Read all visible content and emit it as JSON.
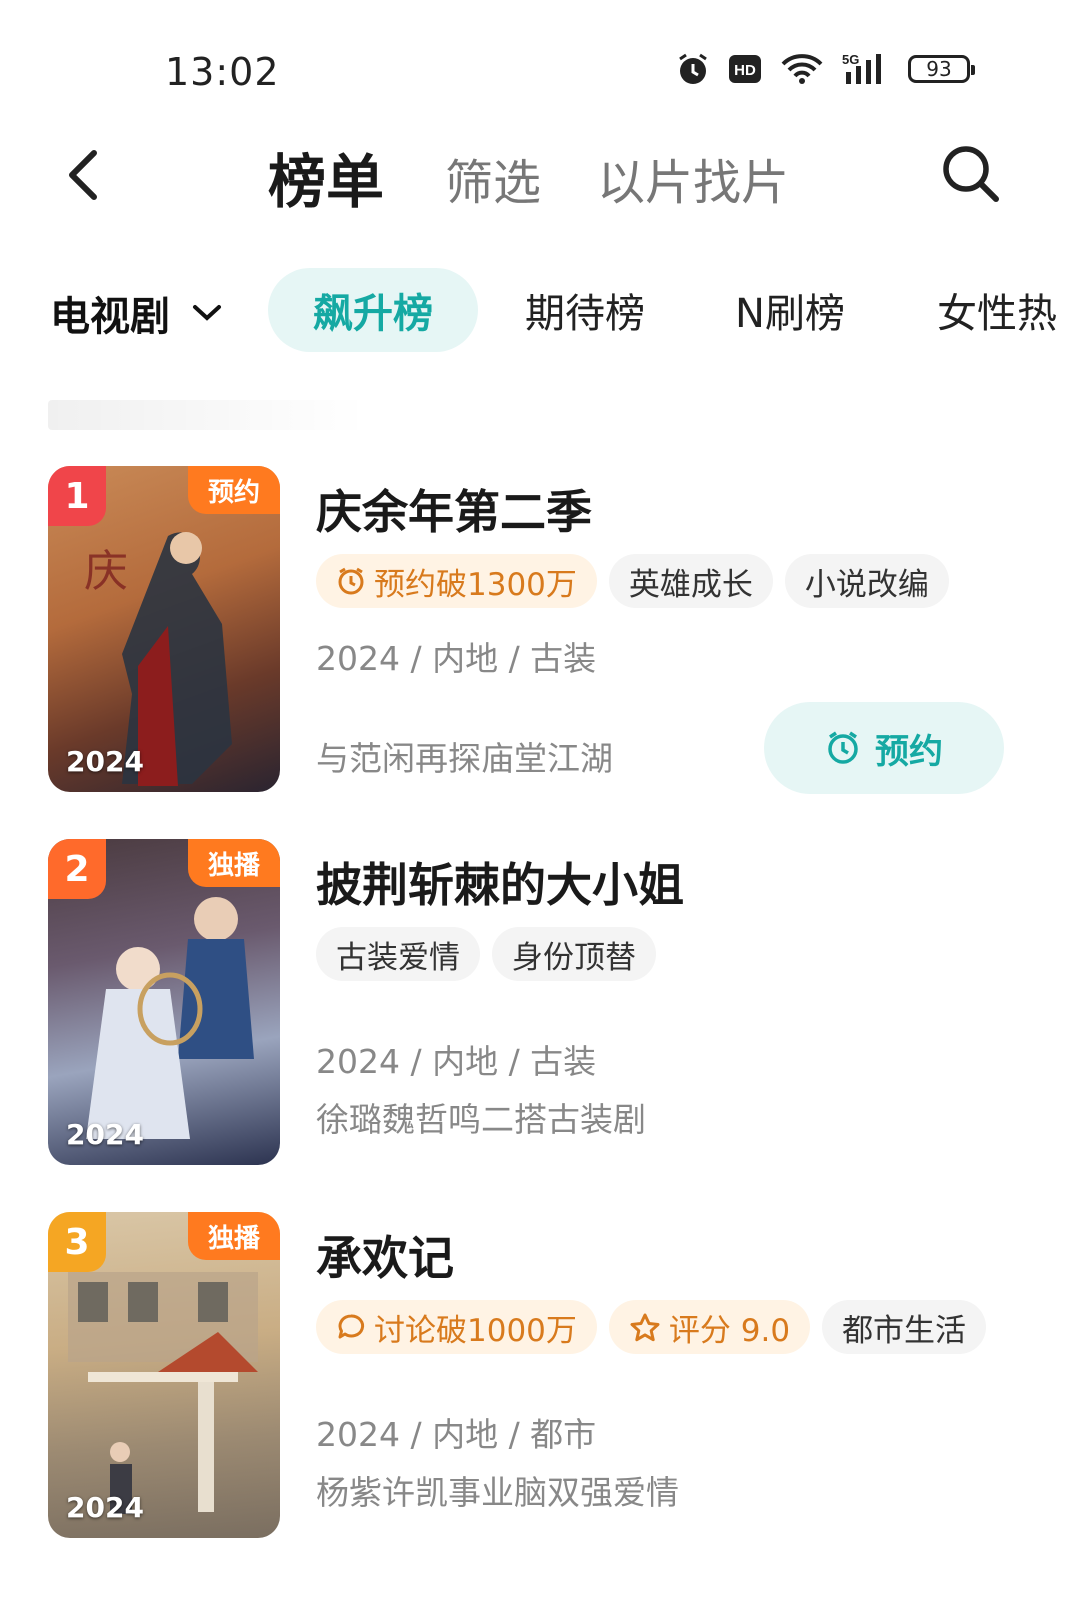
{
  "status_bar": {
    "time": "13:02",
    "icons": [
      "alarm-icon",
      "hd-icon",
      "wifi-icon",
      "5g-signal-icon"
    ],
    "battery": "93"
  },
  "header": {
    "tabs": [
      "榜单",
      "筛选",
      "以片找片"
    ],
    "icons": [
      "back-arrow-icon",
      "search-icon"
    ]
  },
  "categories": {
    "selected": "电视剧",
    "pills": [
      "飙升榜",
      "期待榜",
      "N刷榜",
      "女性热"
    ],
    "active_color": "#15a9a3"
  },
  "items": [
    {
      "rank": "1",
      "rank_color": "#f0454a",
      "badge": "预约",
      "poster_year": "2024",
      "title": "庆余年第二季",
      "tags": [
        {
          "text": "预约破1300万",
          "highlight": true,
          "icon": "alarm-icon"
        },
        {
          "text": "英雄成长",
          "highlight": false
        },
        {
          "text": "小说改编",
          "highlight": false
        }
      ],
      "meta": "2024 / 内地 / 古装",
      "desc": "与范闲再探庙堂江湖",
      "button": "预约"
    },
    {
      "rank": "2",
      "rank_color": "#ff6a2b",
      "badge": "独播",
      "poster_year": "2024",
      "title": "披荆斩棘的大小姐",
      "tags": [
        {
          "text": "古装爱情",
          "highlight": false
        },
        {
          "text": "身份顶替",
          "highlight": false
        }
      ],
      "meta": "2024 / 内地 / 古装",
      "desc": "徐璐魏哲鸣二搭古装剧"
    },
    {
      "rank": "3",
      "rank_color": "#f5a623",
      "badge": "独播",
      "poster_year": "2024",
      "title": "承欢记",
      "tags": [
        {
          "text": "讨论破1000万",
          "highlight": true,
          "icon": "chat-icon"
        },
        {
          "text": "评分 9.0",
          "highlight": true,
          "icon": "star-icon"
        },
        {
          "text": "都市生活",
          "highlight": false
        }
      ],
      "meta": "2024 / 内地 / 都市",
      "desc": "杨紫许凯事业脑双强爱情"
    }
  ]
}
